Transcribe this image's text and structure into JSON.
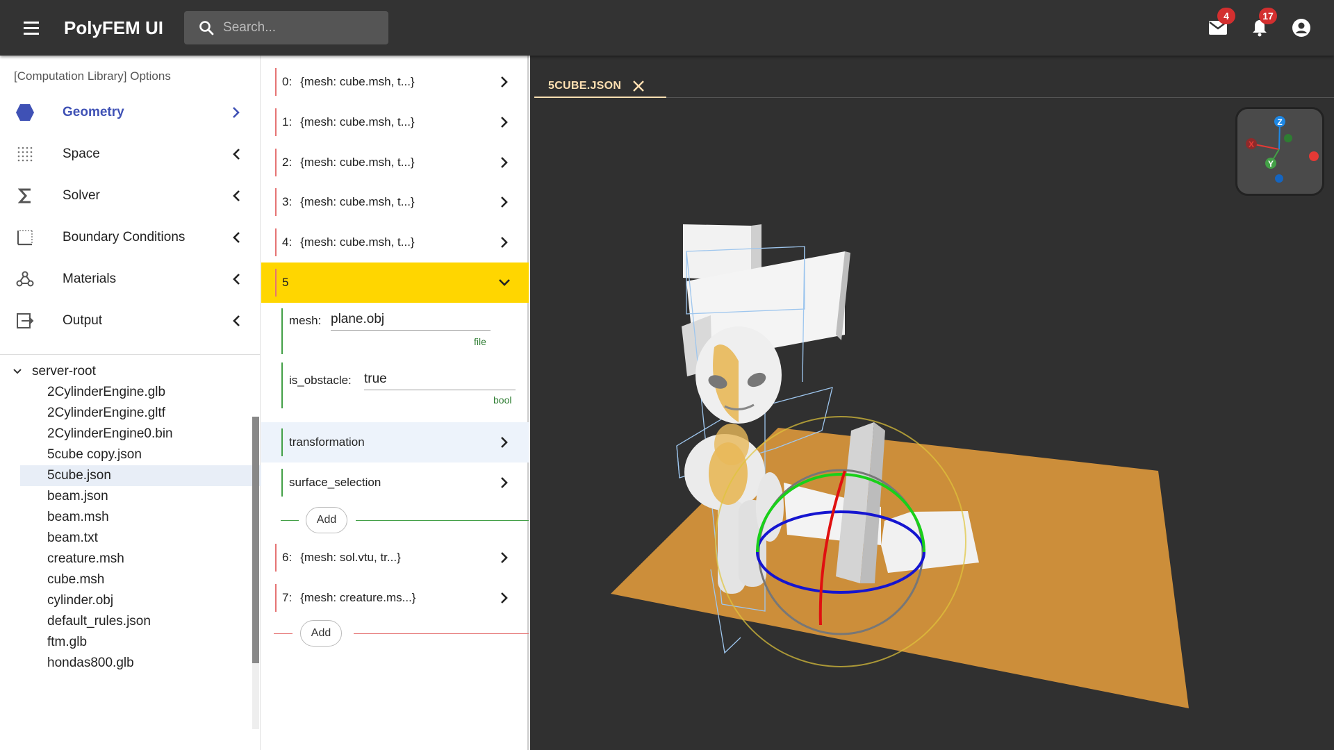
{
  "appbar": {
    "title": "PolyFEM UI",
    "search_placeholder": "Search...",
    "mail_count": "4",
    "notif_count": "17",
    "icons": [
      "menu-icon",
      "search-icon",
      "mail-icon",
      "bell-icon",
      "account-icon"
    ]
  },
  "left": {
    "header": "[Computation Library] Options",
    "nav": [
      {
        "label": "Geometry",
        "icon": "hexagon-icon",
        "active": true
      },
      {
        "label": "Space",
        "icon": "grid-dots-icon"
      },
      {
        "label": "Solver",
        "icon": "sigma-icon"
      },
      {
        "label": "Boundary Conditions",
        "icon": "border-icon"
      },
      {
        "label": "Materials",
        "icon": "webhook-icon"
      },
      {
        "label": "Output",
        "icon": "export-icon"
      }
    ],
    "tree": {
      "root": "server-root",
      "files": [
        "2CylinderEngine.glb",
        "2CylinderEngine.gltf",
        "2CylinderEngine0.bin",
        "5cube copy.json",
        "5cube.json",
        "beam.json",
        "beam.msh",
        "beam.txt",
        "creature.msh",
        "cube.msh",
        "cylinder.obj",
        "default_rules.json",
        "ftm.glb",
        "hondas800.glb"
      ],
      "selected": "5cube.json"
    }
  },
  "mid": {
    "rows": [
      {
        "index": "0:",
        "text": "{mesh: cube.msh, t...}"
      },
      {
        "index": "1:",
        "text": "{mesh: cube.msh, t...}"
      },
      {
        "index": "2:",
        "text": "{mesh: cube.msh, t...}"
      },
      {
        "index": "3:",
        "text": "{mesh: cube.msh, t...}"
      },
      {
        "index": "4:",
        "text": "{mesh: cube.msh, t...}"
      }
    ],
    "expanded": {
      "label": "5",
      "mesh_label": "mesh:",
      "mesh_value": "plane.obj",
      "mesh_hint": "file",
      "obstacle_label": "is_obstacle:",
      "obstacle_value": "true",
      "obstacle_hint": "bool",
      "transformation": "transformation",
      "surface_selection": "surface_selection",
      "add": "Add"
    },
    "rows_after": [
      {
        "index": "6:",
        "text": "{mesh: sol.vtu, tr...}"
      },
      {
        "index": "7:",
        "text": "{mesh: creature.ms...}"
      }
    ],
    "add": "Add"
  },
  "viewer": {
    "tab_label": "5CUBE.JSON",
    "axis_labels": [
      "Z",
      "X",
      "Y"
    ],
    "colors": {
      "plane": "#cc8e3a",
      "x": "#e53935",
      "y": "#43a047",
      "z": "#1e88e5"
    }
  }
}
